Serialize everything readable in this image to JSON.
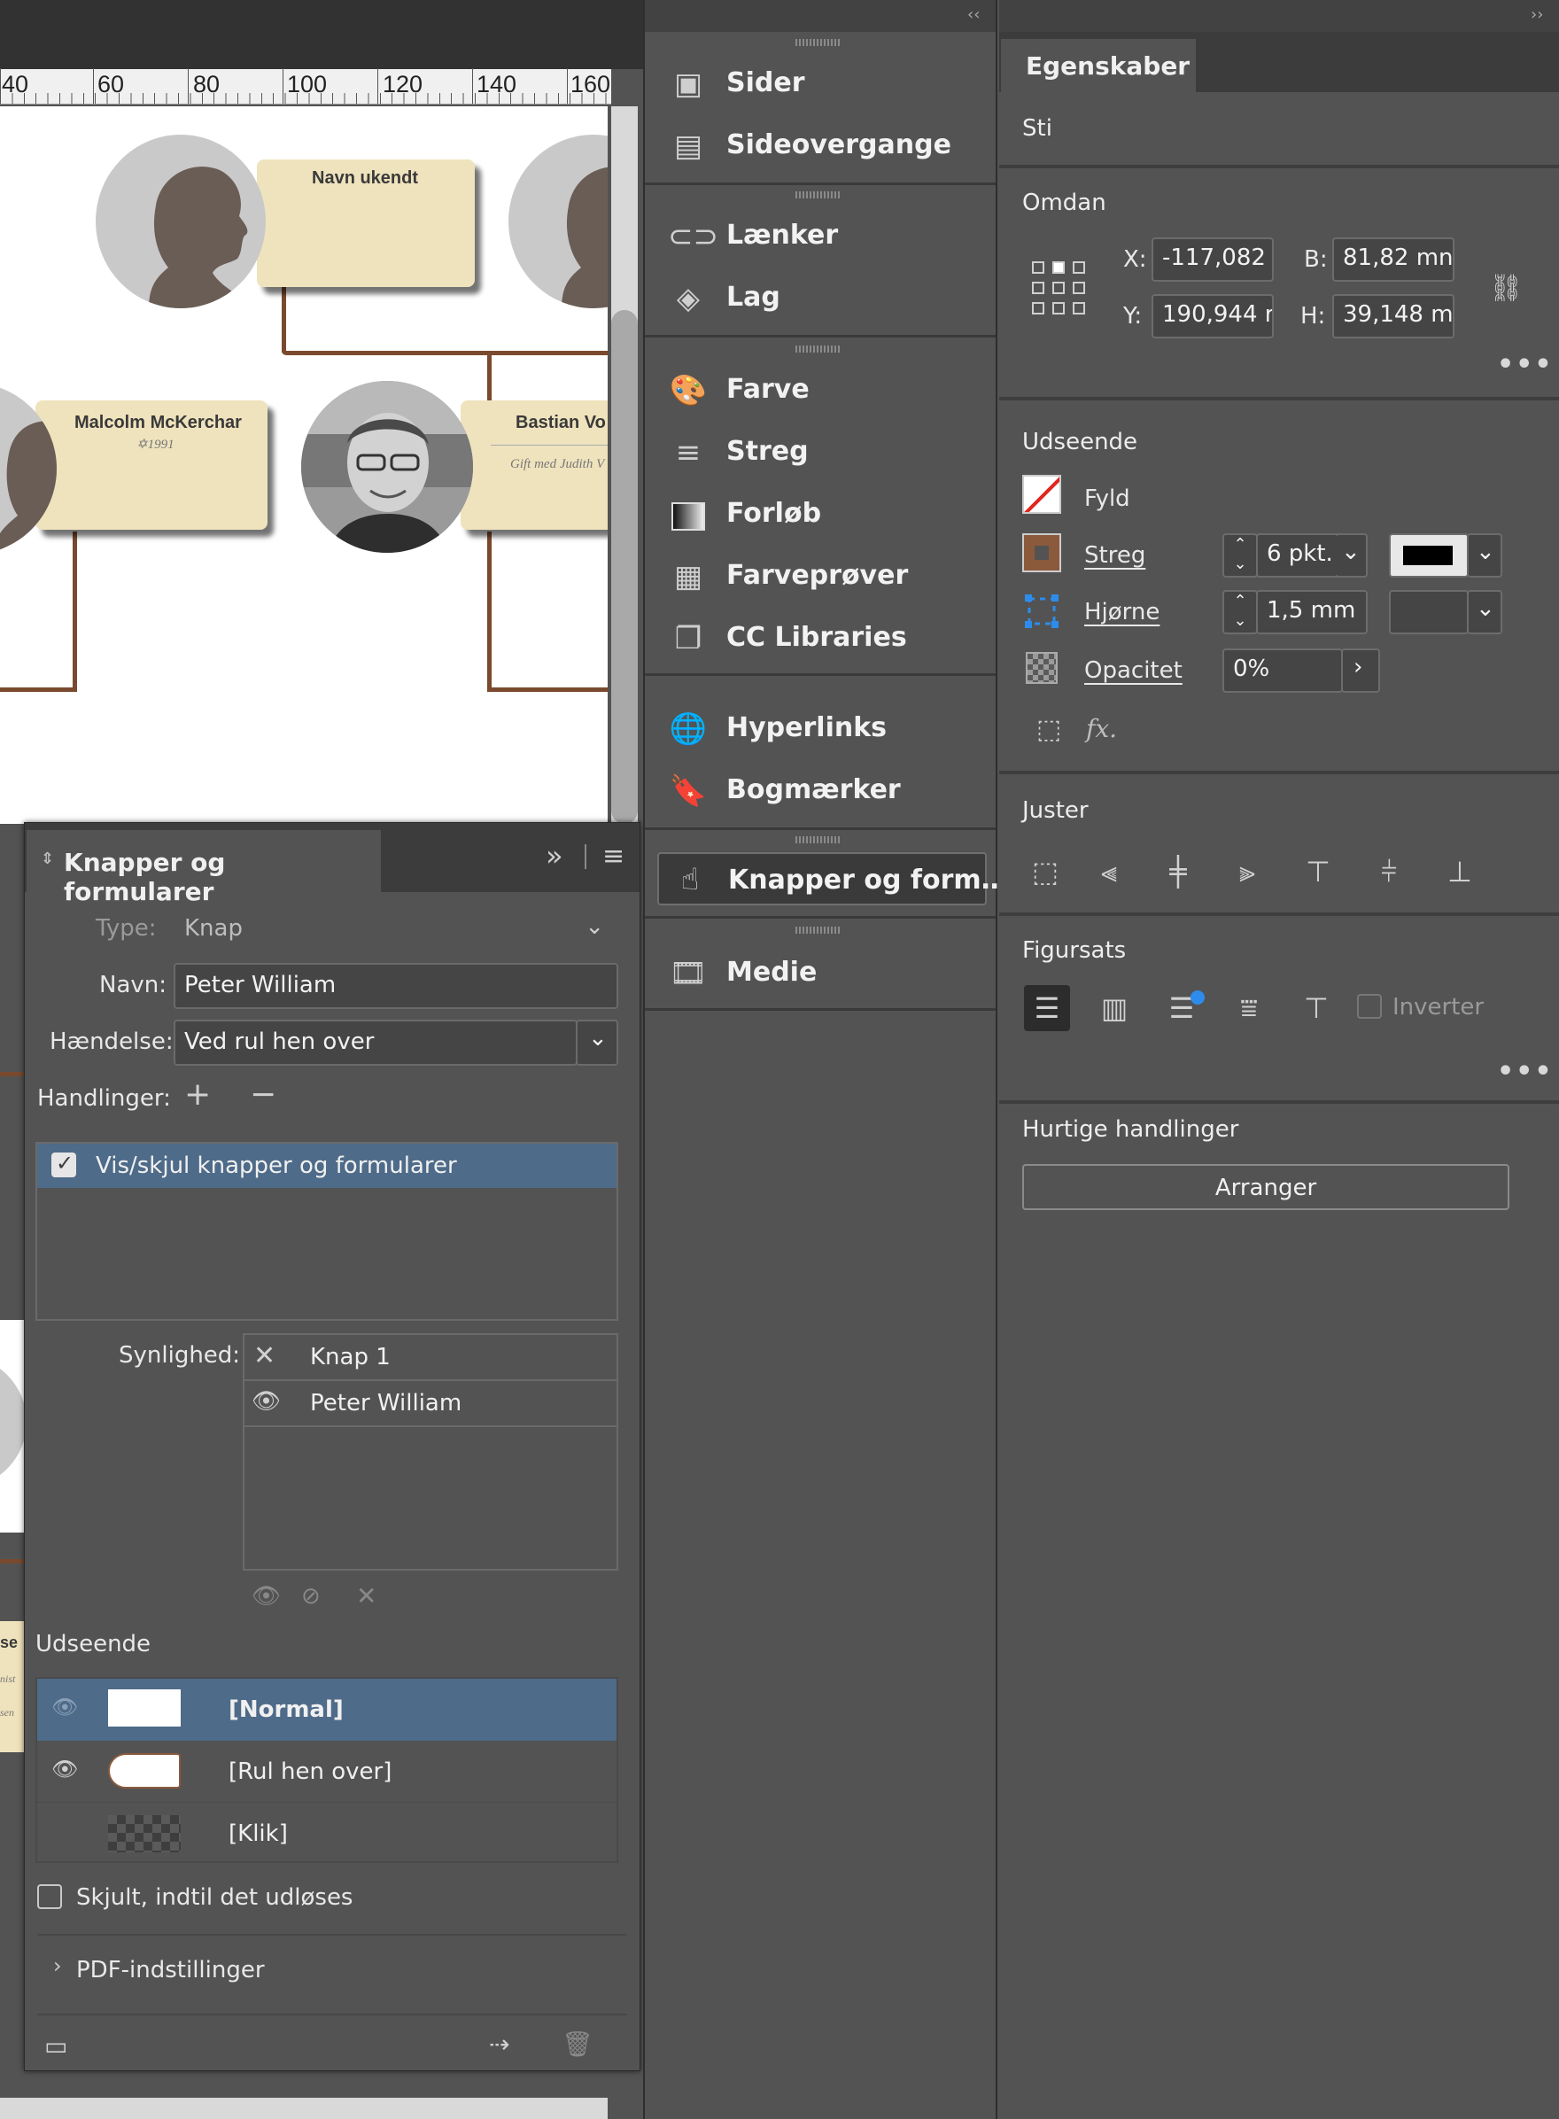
{
  "canvas": {
    "ruler_labels": [
      "40",
      "60",
      "80",
      "100",
      "120",
      "140",
      "160"
    ],
    "cards": [
      {
        "name": "Navn ukendt",
        "sub": ""
      },
      {
        "name": "Malcolm McKerchar",
        "sub": "✡1991"
      },
      {
        "name": "Bastian Vo",
        "sub": "Gift med Judith V"
      },
      {
        "name": "se",
        "sub": "nist"
      },
      {
        "name": "",
        "sub": "sen"
      }
    ]
  },
  "buttons_panel": {
    "tab_title": "Knapper og formularer",
    "type_label": "Type:",
    "type_value": "Knap",
    "name_label": "Navn:",
    "name_value": "Peter William",
    "event_label": "Hændelse:",
    "event_value": "Ved rul hen over",
    "actions_label": "Handlinger:",
    "actions": [
      {
        "label": "Vis/skjul knapper og formularer",
        "checked": true
      }
    ],
    "visibility_label": "Synlighed:",
    "visibility_items": [
      {
        "label": "Knap 1",
        "state": "hide"
      },
      {
        "label": "Peter William",
        "state": "show"
      }
    ],
    "appearance_label": "Udseende",
    "appearance_states": [
      {
        "label": "[Normal]",
        "selected": true
      },
      {
        "label": "[Rul hen over]",
        "selected": false
      },
      {
        "label": "[Klik]",
        "selected": false
      }
    ],
    "hidden_label": "Skjult, indtil det udløses",
    "pdf_label": "PDF-indstillinger"
  },
  "dock": {
    "collapse_glyph": "‹‹",
    "groups": [
      [
        {
          "label": "Sider",
          "icon": "pages-icon"
        },
        {
          "label": "Sideovergange",
          "icon": "page-transitions-icon"
        }
      ],
      [
        {
          "label": "Lænker",
          "icon": "links-icon"
        },
        {
          "label": "Lag",
          "icon": "layers-icon"
        }
      ],
      [
        {
          "label": "Farve",
          "icon": "color-icon"
        },
        {
          "label": "Streg",
          "icon": "stroke-icon"
        },
        {
          "label": "Forløb",
          "icon": "gradient-icon"
        },
        {
          "label": "Farveprøver",
          "icon": "swatches-icon"
        },
        {
          "label": "CC Libraries",
          "icon": "cc-libraries-icon"
        }
      ],
      [
        {
          "label": "Hyperlinks",
          "icon": "hyperlinks-icon"
        },
        {
          "label": "Bogmærker",
          "icon": "bookmarks-icon"
        }
      ],
      [
        {
          "label": "Knapper og form…",
          "icon": "buttons-forms-icon",
          "active": true
        }
      ],
      [
        {
          "label": "Medie",
          "icon": "media-icon"
        }
      ]
    ]
  },
  "properties": {
    "expand_glyph": "››",
    "tab_title": "Egenskaber",
    "object_type": "Sti",
    "transform": {
      "title": "Omdan",
      "x_label": "X:",
      "x_value": "-117,082",
      "y_label": "Y:",
      "y_value": "190,944 r",
      "w_label": "B:",
      "w_value": "81,82 mn",
      "h_label": "H:",
      "h_value": "39,148 m"
    },
    "appearance": {
      "title": "Udseende",
      "fill_label": "Fyld",
      "stroke_label": "Streg",
      "stroke_weight": "6 pkt.",
      "corner_label": "Hjørne",
      "corner_value": "1,5 mm",
      "opacity_label": "Opacitet",
      "opacity_value": "0%",
      "fx_label": "fx."
    },
    "align": {
      "title": "Juster"
    },
    "text_wrap": {
      "title": "Figursats",
      "invert_label": "Inverter"
    },
    "quick_actions": {
      "title": "Hurtige handlinger",
      "arrange_label": "Arranger"
    },
    "colors": {
      "stroke_swatch": "#8b5a3c",
      "stroke_color": "#000000",
      "selection_blue": "#4e6b89",
      "accent_blue": "#2d8ceb"
    }
  }
}
